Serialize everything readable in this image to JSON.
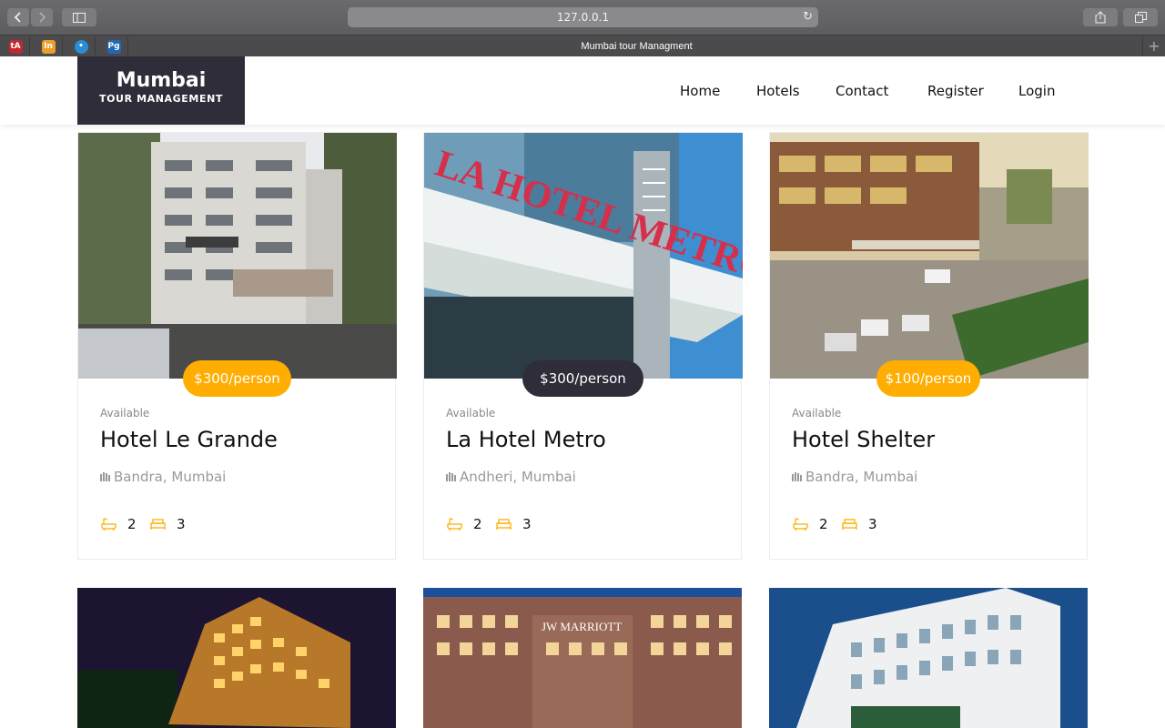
{
  "browser": {
    "url": "127.0.0.1",
    "tab_title": "Mumbai tour Managment",
    "favicons": [
      {
        "name": "favicon-1",
        "text": "tA",
        "bg": "#c0282e"
      },
      {
        "name": "favicon-2",
        "text": "In",
        "bg": "#e9a02b"
      },
      {
        "name": "favicon-3",
        "text": "•",
        "bg": "#2a8ed6"
      },
      {
        "name": "favicon-4",
        "text": "Pg",
        "bg": "#2267b3"
      }
    ]
  },
  "site": {
    "logo_main": "Mumbai",
    "logo_sub": "TOUR MANAGEMENT",
    "nav": [
      "Home",
      "Hotels",
      "Contact",
      "Register",
      "Login"
    ]
  },
  "colors": {
    "accent": "#ffad00",
    "dark": "#2f2d39"
  },
  "hotels": [
    {
      "name": "Hotel Le Grande",
      "price": "$300/person",
      "status": "Available",
      "location": "Bandra, Mumbai",
      "baths": "2",
      "beds": "3",
      "price_style": "accent"
    },
    {
      "name": "La Hotel Metro",
      "price": "$300/person",
      "status": "Available",
      "location": "Andheri, Mumbai",
      "baths": "2",
      "beds": "3",
      "price_style": "dark"
    },
    {
      "name": "Hotel Shelter",
      "price": "$100/person",
      "status": "Available",
      "location": "Bandra, Mumbai",
      "baths": "2",
      "beds": "3",
      "price_style": "accent"
    }
  ]
}
